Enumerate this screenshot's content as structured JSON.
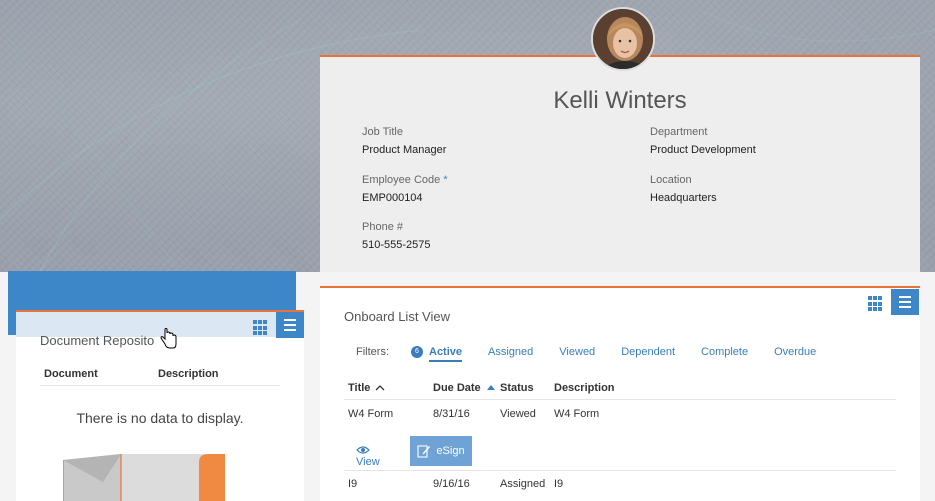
{
  "profile": {
    "name": "Kelli Winters",
    "fields": {
      "job_title_label": "Job Title",
      "job_title": "Product Manager",
      "department_label": "Department",
      "department": "Product Development",
      "employee_code_label": "Employee Code",
      "required_mark": "*",
      "employee_code": "EMP000104",
      "location_label": "Location",
      "location": "Headquarters",
      "phone_label": "Phone #",
      "phone": "510-555-2575"
    }
  },
  "document_repository": {
    "title": "Document Reposito",
    "columns": [
      "Document",
      "Description"
    ],
    "empty_message": "There is no data to display."
  },
  "onboard_list": {
    "title": "Onboard List View",
    "filters_label": "Filters:",
    "active_count": "6",
    "filters": [
      "Active",
      "Assigned",
      "Viewed",
      "Dependent",
      "Complete",
      "Overdue"
    ],
    "columns": [
      "Title",
      "Due Date",
      "Status",
      "Description"
    ],
    "rows": [
      {
        "title": "W4 Form",
        "due_date": "8/31/16",
        "status": "Viewed",
        "description": "W4 Form"
      },
      {
        "title": "I9",
        "due_date": "9/16/16",
        "status": "Assigned",
        "description": "I9"
      }
    ],
    "actions": {
      "view": "View",
      "esign": "eSign"
    }
  },
  "colors": {
    "accent_orange": "#e8743b",
    "primary_blue": "#3d87c9",
    "link_blue": "#3a7dbd"
  },
  "icons": [
    "grid-icon",
    "menu-icon",
    "eye-icon",
    "pen-icon",
    "sort-up-icon",
    "sort-caret-icon",
    "hand-cursor-icon",
    "folder-icon"
  ]
}
